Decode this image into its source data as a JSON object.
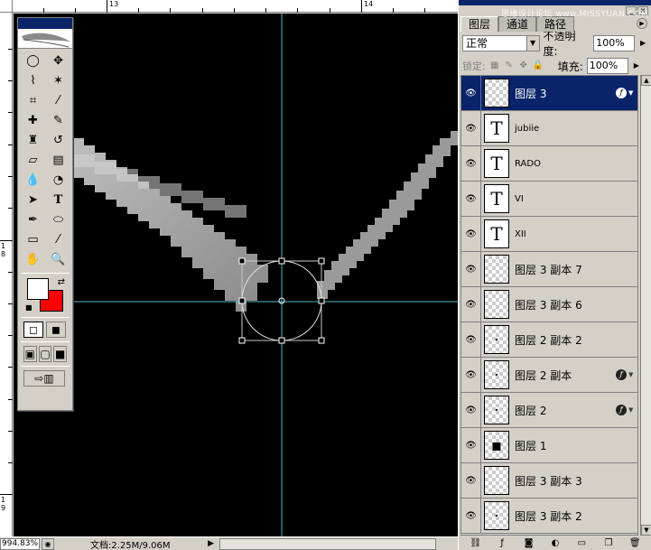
{
  "ruler": {
    "top_labels": [
      "13",
      "14"
    ],
    "left_labels": [
      "1\n8",
      "1\n9"
    ]
  },
  "statusbar": {
    "zoom": "994.83%",
    "doc_info": "文档:2.25M/9.06M",
    "arrow": "▶"
  },
  "watermark": "思缘设计论坛 www.MISSYUAN.COM",
  "panel": {
    "tabs": [
      "图层",
      "通道",
      "路径"
    ],
    "blend_mode": "正常",
    "opacity_label": "不透明度:",
    "opacity_value": "100%",
    "lock_label": "锁定:",
    "fill_label": "填充:",
    "fill_value": "100%"
  },
  "layers": [
    {
      "name": "图层 3",
      "type": "raster",
      "selected": true,
      "fx": true,
      "thumb_glyph": ""
    },
    {
      "name": "jubiie",
      "type": "text",
      "selected": false,
      "fx": false,
      "thumb_glyph": "T"
    },
    {
      "name": "RADO",
      "type": "text",
      "selected": false,
      "fx": false,
      "thumb_glyph": "T"
    },
    {
      "name": "VI",
      "type": "text",
      "selected": false,
      "fx": false,
      "thumb_glyph": "T"
    },
    {
      "name": "XII",
      "type": "text",
      "selected": false,
      "fx": false,
      "thumb_glyph": "T"
    },
    {
      "name": "图层 3 副本 7",
      "type": "raster",
      "selected": false,
      "fx": false,
      "thumb_glyph": ""
    },
    {
      "name": "图层 3 副本 6",
      "type": "raster",
      "selected": false,
      "fx": false,
      "thumb_glyph": ""
    },
    {
      "name": "图层 2 副本 2",
      "type": "raster",
      "selected": false,
      "fx": false,
      "thumb_glyph": "·"
    },
    {
      "name": "图层 2 副本",
      "type": "raster",
      "selected": false,
      "fx": true,
      "thumb_glyph": "·"
    },
    {
      "name": "图层 2",
      "type": "raster",
      "selected": false,
      "fx": true,
      "thumb_glyph": "·"
    },
    {
      "name": "图层 1",
      "type": "raster",
      "selected": false,
      "fx": false,
      "thumb_glyph": "▪"
    },
    {
      "name": "图层 3 副本 3",
      "type": "raster",
      "selected": false,
      "fx": false,
      "thumb_glyph": ""
    },
    {
      "name": "图层 3 副本 2",
      "type": "raster",
      "selected": false,
      "fx": false,
      "thumb_glyph": "·"
    }
  ],
  "icons": {
    "eye": "eye-icon",
    "fx": "layer-style-icon"
  },
  "colors": {
    "foreground": "#ffffff",
    "background": "#ff0000",
    "selection": "#0a246a",
    "guide": "#4fb8c8"
  }
}
